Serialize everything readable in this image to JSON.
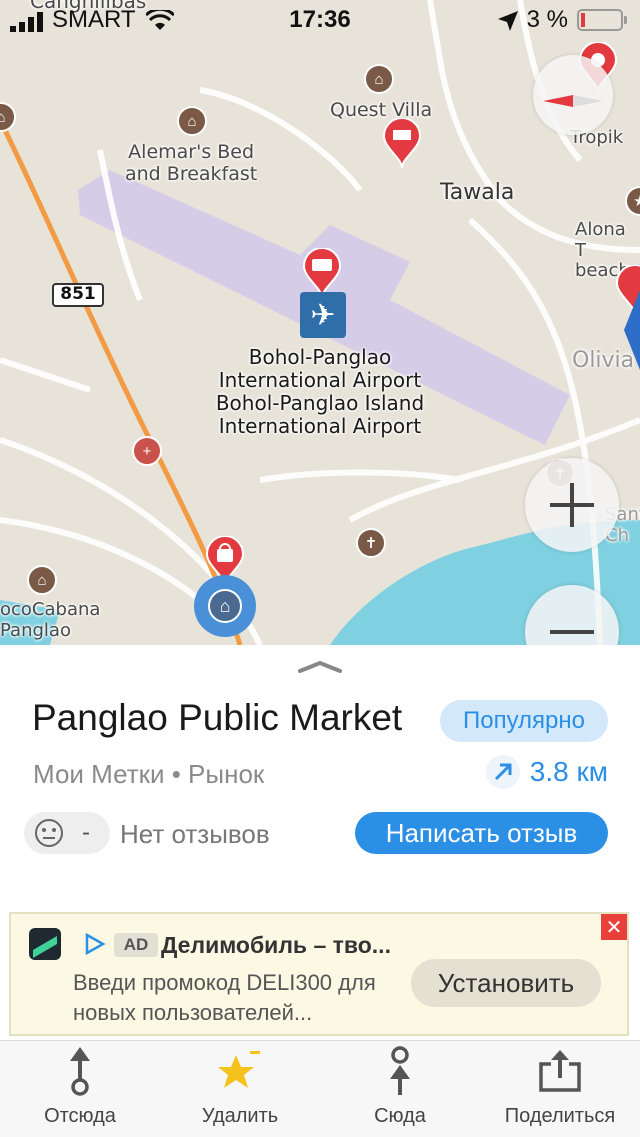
{
  "status_bar": {
    "carrier": "SMART",
    "time": "17:36",
    "battery_percent": "3 %"
  },
  "map": {
    "labels": {
      "caghilibas": "Canghilibas",
      "quest_villa": "Quest Villa",
      "alemars": "Alemar's Bed\nand Breakfast",
      "tawala": "Tawala",
      "tropik": "Tropik",
      "alona": "Alona T\nbeach",
      "olivia": "Olivia",
      "road_number": "851",
      "airport_line1": "Bohol-Panglao",
      "airport_line2": "International Airport",
      "airport_line3": "Bohol-Panglao Island",
      "airport_line4": "International Airport",
      "cococabana": "ocoCabana\nPanglao",
      "santa": "Sant\nCh"
    },
    "water_color": "#7fd0e0",
    "airport_color": "#d5cde8",
    "road_orange": "#f39a45"
  },
  "place": {
    "name": "Panglao Public Market",
    "badge": "Популярно",
    "subtitle": "Мои Метки • Рынок",
    "distance": "3.8 км",
    "rating_dash": "-",
    "no_reviews": "Нет отзывов",
    "write_review": "Написать отзыв"
  },
  "ad": {
    "badge": "AD",
    "title": "Делимобиль – тво...",
    "text": "Введи промокод DELI300 для новых пользователей...",
    "install": "Установить",
    "close": "✕"
  },
  "toolbar": {
    "from": "Отсюда",
    "delete": "Удалить",
    "to": "Сюда",
    "share": "Поделиться"
  },
  "colors": {
    "accent": "#2b8fe6",
    "pin_red": "#e23a40",
    "star": "#f4c21a"
  }
}
